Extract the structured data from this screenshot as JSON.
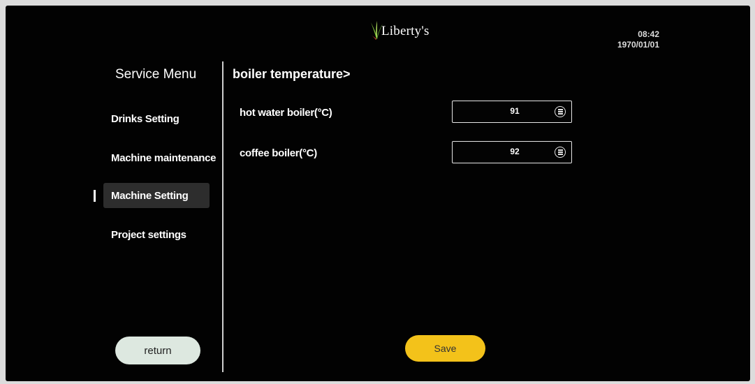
{
  "header": {
    "logo_text": "Liberty's",
    "time": "08:42",
    "date": "1970/01/01"
  },
  "sidebar": {
    "title": "Service Menu",
    "items": [
      {
        "label": "Drinks Setting",
        "active": false
      },
      {
        "label": "Machine maintenance",
        "active": false
      },
      {
        "label": "Machine Setting",
        "active": true
      },
      {
        "label": "Project settings",
        "active": false
      }
    ],
    "return_label": "return"
  },
  "main": {
    "section_title": "boiler temperature>",
    "fields": [
      {
        "label": "hot water boiler(°C)",
        "value": "91",
        "icon": "keypad-icon"
      },
      {
        "label": "coffee boiler(°C)",
        "value": "92",
        "icon": "keypad-icon"
      }
    ],
    "save_label": "Save"
  },
  "colors": {
    "background": "#020202",
    "save_button": "#f3c21a",
    "return_button": "#dde8e0",
    "active_item": "#2d2d2d"
  }
}
